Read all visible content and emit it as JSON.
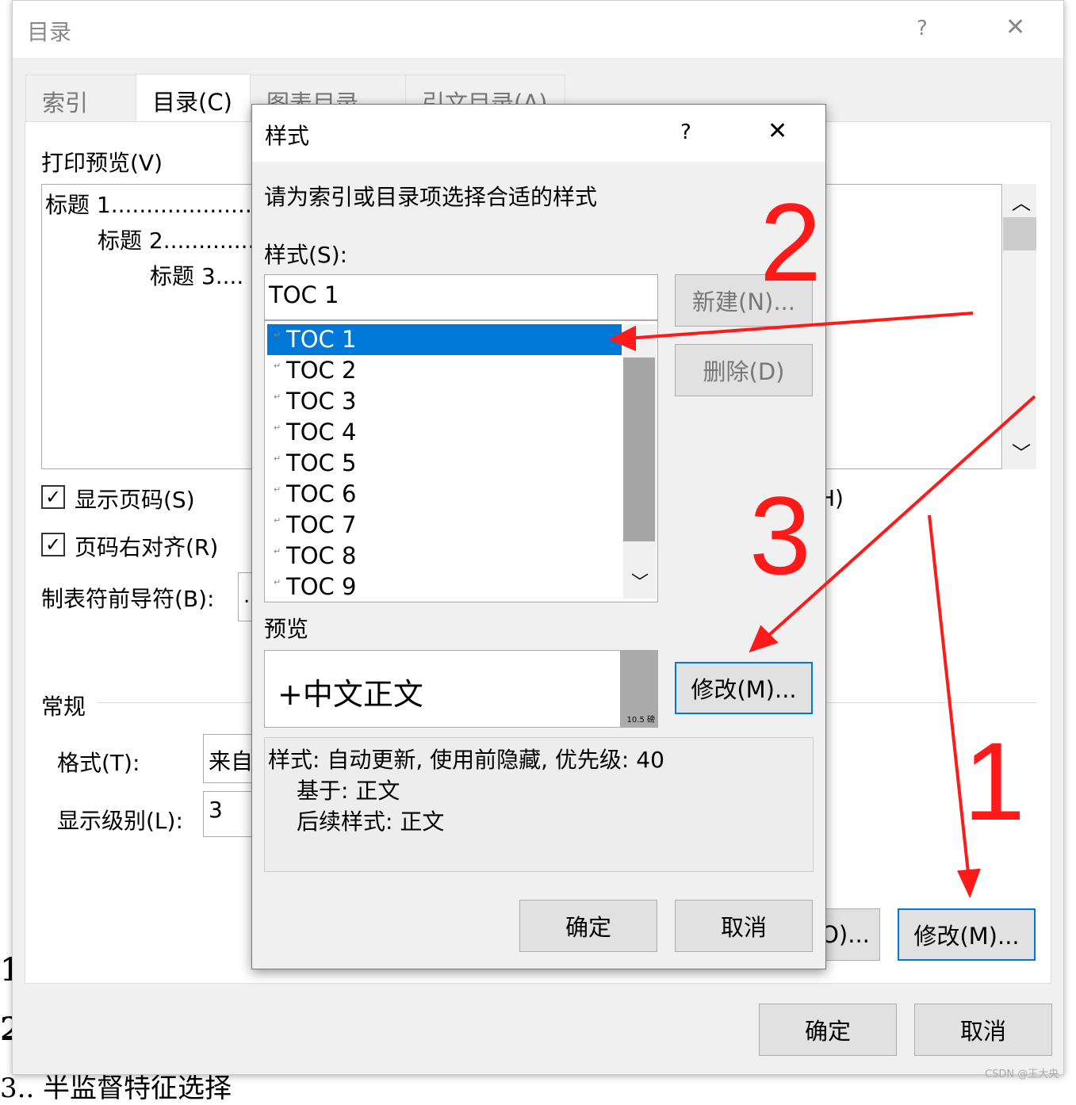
{
  "outer_dialog": {
    "title": "目录",
    "help": "?",
    "close": "✕",
    "tabs": [
      "索引(X)",
      "目录(C)",
      "图表目录(F)",
      "引文目录(A)"
    ],
    "print_preview_label": "打印预览(V)",
    "preview_lines": [
      "标题 1......................",
      "标题 2.............",
      "标题 3...."
    ],
    "show_page_numbers": {
      "label": "显示页码(S)",
      "checked": true
    },
    "right_align": {
      "label": "页码右对齐(R)",
      "checked": true
    },
    "tab_leader_label": "制表符前导符(B):",
    "tab_leader_value": "...",
    "web_hyperlink_partial": "H)",
    "general_label": "常规",
    "format_label": "格式(T):",
    "format_value": "来自",
    "levels_label": "显示级别(L):",
    "levels_value": "3",
    "options_button_partial": "O)...",
    "modify_button": "修改(M)...",
    "ok": "确定",
    "cancel": "取消"
  },
  "style_dialog": {
    "title": "样式",
    "help": "?",
    "close": "✕",
    "instruction": "请为索引或目录项选择合适的样式",
    "styles_label": "样式(S):",
    "style_input": "TOC 1",
    "style_list": [
      "TOC 1",
      "TOC 2",
      "TOC 3",
      "TOC 4",
      "TOC 5",
      "TOC 6",
      "TOC 7",
      "TOC 8",
      "TOC 9"
    ],
    "selected_index": 0,
    "new_button": "新建(N)...",
    "delete_button": "删除(D)",
    "preview_label": "预览",
    "preview_text": "+中文正文",
    "preview_size": "10.5 磅",
    "modify_button": "修改(M)...",
    "description": [
      "样式: 自动更新, 使用前隐藏, 优先级: 40",
      "基于: 正文",
      "后续样式: 正文"
    ],
    "ok": "确定",
    "cancel": "取消"
  },
  "annotations": {
    "n1": "1",
    "n2": "2",
    "n3": "3",
    "color": "#ff1a1a"
  },
  "watermark": "CSDN @王大央",
  "background_doc_text": "3.. 半监督特征选择"
}
